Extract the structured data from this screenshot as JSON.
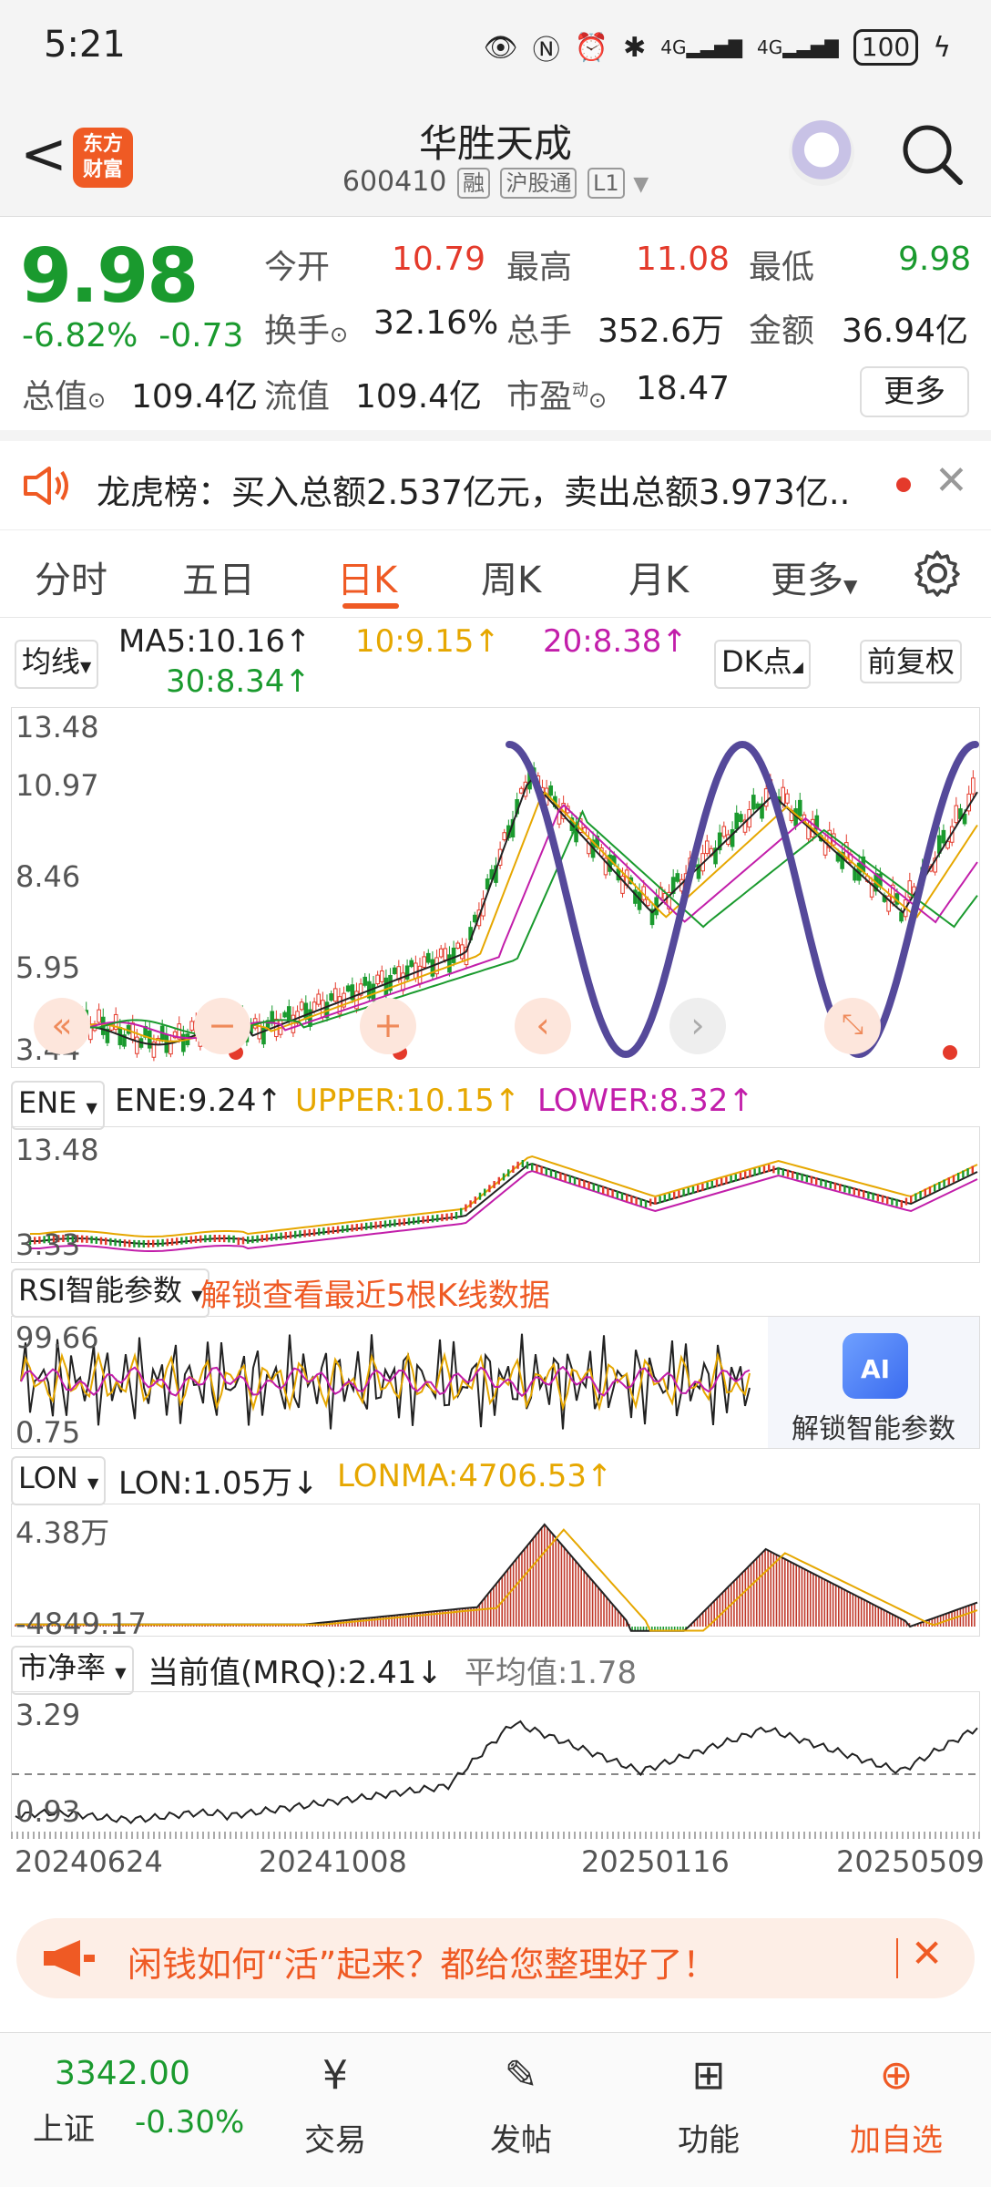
{
  "status_bar": {
    "time": "5:21",
    "battery": "100",
    "network1": "4G",
    "network2": "4G"
  },
  "header": {
    "back_label": "<",
    "logo_line1": "东方",
    "logo_line2": "财富",
    "stock_name": "华胜天成",
    "stock_code": "600410",
    "tags": [
      "融",
      "沪股通",
      "L1"
    ]
  },
  "quote": {
    "price": "9.98",
    "change_pct": "-6.82%",
    "change_abs": "-0.73",
    "open_label": "今开",
    "open": "10.79",
    "high_label": "最高",
    "high": "11.08",
    "low_label": "最低",
    "low": "9.98",
    "turnover_label": "换手",
    "turnover": "32.16%",
    "volume_label": "总手",
    "volume": "352.6万",
    "amount_label": "金额",
    "amount": "36.94亿",
    "mktcap_label": "总值",
    "mktcap": "109.4亿",
    "float_label": "流值",
    "float": "109.4亿",
    "pe_label": "市盈",
    "pe_sup": "动",
    "pe": "18.47",
    "more_button": "更多"
  },
  "news": {
    "text": "龙虎榜：买入总额2.537亿元，卖出总额3.973亿..."
  },
  "tabs": [
    "分时",
    "五日",
    "日K",
    "周K",
    "月K",
    "更多"
  ],
  "active_tab": "日K",
  "kline": {
    "ma_select": "均线",
    "ma5": "MA5:10.16↑",
    "ma10": "10:9.15↑",
    "ma20": "20:8.38↑",
    "ma30": "30:8.34↑",
    "dk_button": "DK点",
    "adjust_button": "前复权",
    "y_ticks": [
      "13.48",
      "10.97",
      "8.46",
      "5.95",
      "3.44"
    ]
  },
  "ene": {
    "select": "ENE",
    "ene": "ENE:9.24↑",
    "upper": "UPPER:10.15↑",
    "lower": "LOWER:8.32↑",
    "y_ticks": [
      "13.48",
      "3.33"
    ]
  },
  "rsi": {
    "select": "RSI智能参数",
    "unlock_text": "解锁查看最近5根K线数据",
    "y_ticks": [
      "99.66",
      "0.75"
    ],
    "ai_badge": "AI",
    "ai_label": "解锁智能参数"
  },
  "lon": {
    "select": "LON",
    "lon": "LON:1.05万↓",
    "lonma": "LONMA:4706.53↑",
    "y_ticks": [
      "4.38万",
      "-4849.17"
    ]
  },
  "pb": {
    "select": "市净率",
    "current": "当前值(MRQ):2.41↓",
    "avg": "平均值:1.78",
    "y_ticks": [
      "3.29",
      "0.93"
    ]
  },
  "dates": [
    "20240624",
    "20241008",
    "20250116",
    "20250509"
  ],
  "banner": {
    "text": "闲钱如何“活”起来？都给您整理好了！"
  },
  "bottom_bar": {
    "index_value": "3342.00",
    "index_name": "上证",
    "index_change": "-0.30%",
    "items": [
      "交易",
      "发帖",
      "功能",
      "加自选"
    ]
  },
  "colors": {
    "up": "#e43a2b",
    "down": "#1a9a2e",
    "accent": "#ef5a24",
    "ma10": "#e6a700",
    "ma20": "#c21eaa"
  }
}
